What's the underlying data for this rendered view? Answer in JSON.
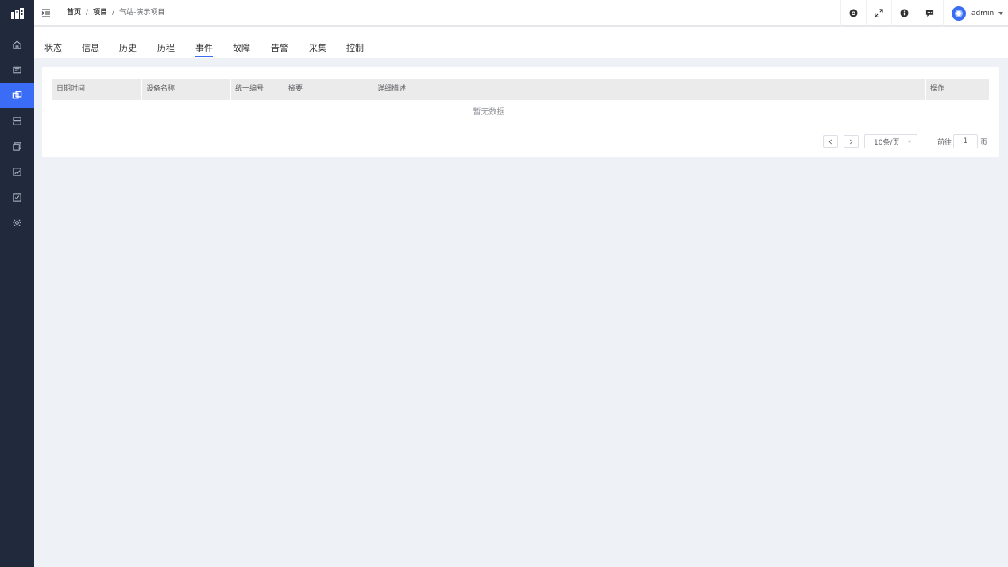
{
  "colors": {
    "accent": "#3a6cf6",
    "sidebar_bg": "#212a3c",
    "content_bg": "#eef1f6"
  },
  "sidebar": {
    "items": [
      {
        "icon": "home-icon"
      },
      {
        "icon": "monitor-icon"
      },
      {
        "icon": "project-icon",
        "active": true
      },
      {
        "icon": "server-icon"
      },
      {
        "icon": "copy-icon"
      },
      {
        "icon": "chart-icon"
      },
      {
        "icon": "report-icon"
      },
      {
        "icon": "gear-icon"
      }
    ]
  },
  "breadcrumb": {
    "home": "首页",
    "separator": "/",
    "projects": "项目",
    "current": "气站-演示项目"
  },
  "topbar": {
    "icons": [
      "github-icon",
      "fullscreen-icon",
      "info-icon",
      "message-icon"
    ],
    "username": "admin"
  },
  "tabs": [
    {
      "label": "状态"
    },
    {
      "label": "信息"
    },
    {
      "label": "历史"
    },
    {
      "label": "历程"
    },
    {
      "label": "事件",
      "active": true
    },
    {
      "label": "故障"
    },
    {
      "label": "告警"
    },
    {
      "label": "采集"
    },
    {
      "label": "控制"
    }
  ],
  "table": {
    "columns": [
      "日期时间",
      "设备名称",
      "统一编号",
      "摘要",
      "详细描述",
      "操作"
    ],
    "empty_text": "暂无数据"
  },
  "pagination": {
    "page_size": "10条/页",
    "goto_prefix": "前往",
    "current_page": "1",
    "goto_suffix": "页"
  }
}
